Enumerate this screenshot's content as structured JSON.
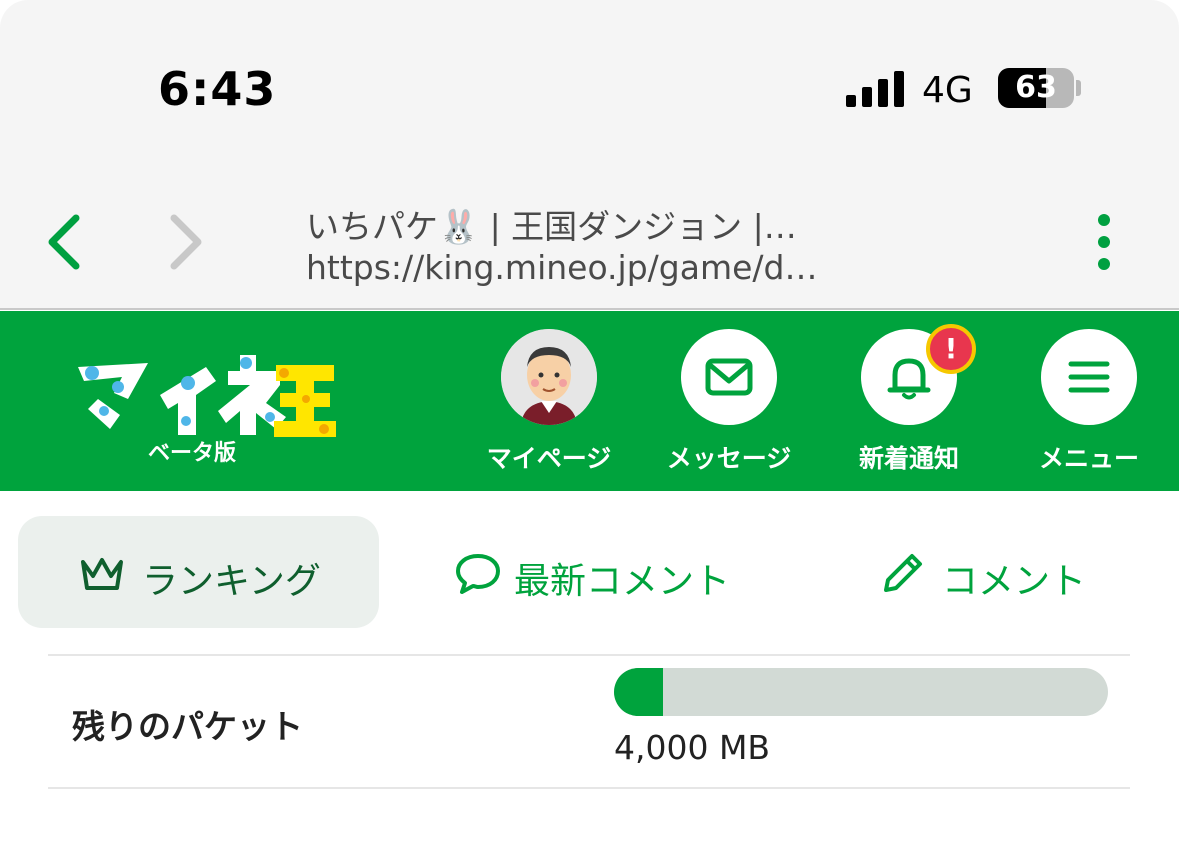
{
  "status_bar": {
    "time": "6:43",
    "network": "4G",
    "battery_percent": "63",
    "battery_level": 0.63
  },
  "browser": {
    "page_title": "いちパケ🐰 | 王国ダンジョン |…",
    "url": "https://king.mineo.jp/game/d…",
    "accent_color": "#00a040"
  },
  "header": {
    "logo_text": "マイネ王",
    "logo_sub": "ベータ版",
    "background_color": "#00a33d",
    "buttons": [
      {
        "label": "マイページ",
        "icon": "avatar"
      },
      {
        "label": "メッセージ",
        "icon": "mail-icon"
      },
      {
        "label": "新着通知",
        "icon": "bell-icon",
        "badge": "!"
      },
      {
        "label": "メニュー",
        "icon": "hamburger-icon"
      }
    ]
  },
  "tabs": [
    {
      "label": "ランキング",
      "icon": "crown-icon",
      "active": true
    },
    {
      "label": "最新コメント",
      "icon": "chat-bubble-icon",
      "active": false
    },
    {
      "label": "コメント",
      "icon": "pencil-icon",
      "active": false
    }
  ],
  "packet": {
    "label": "残りのパケット",
    "value": "4,000 MB",
    "fill_fraction": 0.1
  }
}
